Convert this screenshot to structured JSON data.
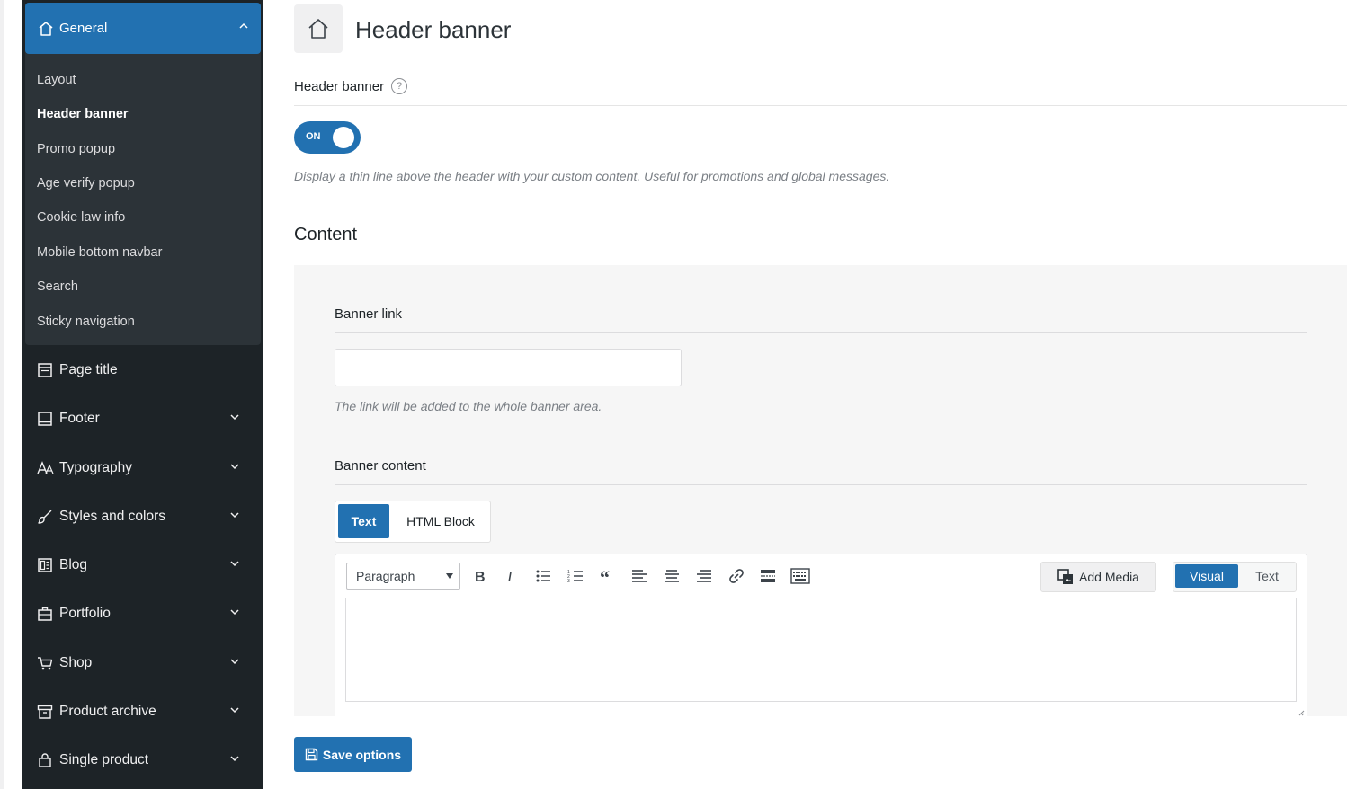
{
  "sidebar": {
    "general": {
      "label": "General",
      "icon": "home-icon",
      "subitems": [
        {
          "label": "Layout"
        },
        {
          "label": "Header banner"
        },
        {
          "label": "Promo popup"
        },
        {
          "label": "Age verify popup"
        },
        {
          "label": "Cookie law info"
        },
        {
          "label": "Mobile bottom navbar"
        },
        {
          "label": "Search"
        },
        {
          "label": "Sticky navigation"
        }
      ]
    },
    "items": [
      {
        "label": "Page title",
        "icon": "page-title-icon"
      },
      {
        "label": "Footer",
        "icon": "footer-icon"
      },
      {
        "label": "Typography",
        "icon": "typography-icon"
      },
      {
        "label": "Styles and colors",
        "icon": "brush-icon"
      },
      {
        "label": "Blog",
        "icon": "blog-icon"
      },
      {
        "label": "Portfolio",
        "icon": "briefcase-icon"
      },
      {
        "label": "Shop",
        "icon": "cart-icon"
      },
      {
        "label": "Product archive",
        "icon": "archive-icon"
      },
      {
        "label": "Single product",
        "icon": "bag-icon"
      }
    ]
  },
  "main": {
    "title": "Header banner",
    "toggle_section": {
      "label": "Header banner",
      "help": "?",
      "toggle_label": "ON",
      "toggle_on": true,
      "description": "Display a thin line above the header with your custom content. Useful for promotions and global messages."
    },
    "content_heading": "Content",
    "banner_link": {
      "label": "Banner link",
      "value": "",
      "description": "The link will be added to the whole banner area."
    },
    "banner_content": {
      "label": "Banner content",
      "tabs": [
        "Text",
        "HTML Block"
      ],
      "active_tab": "Text"
    },
    "editor": {
      "format_select": "Paragraph",
      "add_media": "Add Media",
      "modes": [
        "Visual",
        "Text"
      ],
      "active_mode": "Visual",
      "content": ""
    },
    "save_button": "Save options"
  },
  "colors": {
    "accent": "#2271b1",
    "sidebar_bg": "#1d2327"
  }
}
